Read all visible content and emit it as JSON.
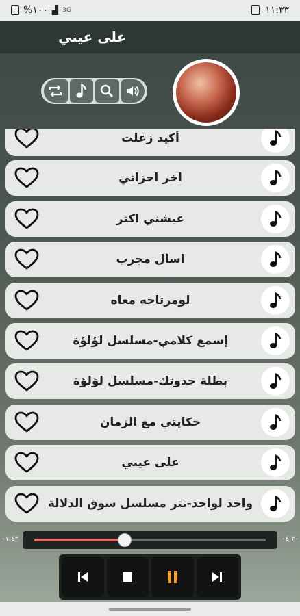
{
  "status_bar": {
    "battery_text": "%١٠٠",
    "network_text": "3G",
    "time": "١١:٣٣"
  },
  "app_bar": {
    "title": "على عيني"
  },
  "controls": [
    "repeat-icon",
    "music-note-icon",
    "search-icon",
    "volume-icon"
  ],
  "songs": [
    {
      "title": "أكيد زعلت"
    },
    {
      "title": "اخر احزاني"
    },
    {
      "title": "عيشني اكتر"
    },
    {
      "title": "اسأل مجرب"
    },
    {
      "title": "لومرتاحه معاه"
    },
    {
      "title": "إسمع كلامي-مسلسل لؤلؤة"
    },
    {
      "title": "بطلة حدوتك-مسلسل لؤلؤة"
    },
    {
      "title": "حكايتي مع الزمان"
    },
    {
      "title": "على عيني"
    },
    {
      "title": "واحد لواحد-تتر مسلسل سوق الدلالة"
    }
  ],
  "player": {
    "elapsed": "٠١:٤٣",
    "duration": "٠٤:٣٠",
    "progress": 0.39,
    "state": "playing",
    "accent_color": "#e86b6b",
    "pause_color": "#f0a030"
  }
}
